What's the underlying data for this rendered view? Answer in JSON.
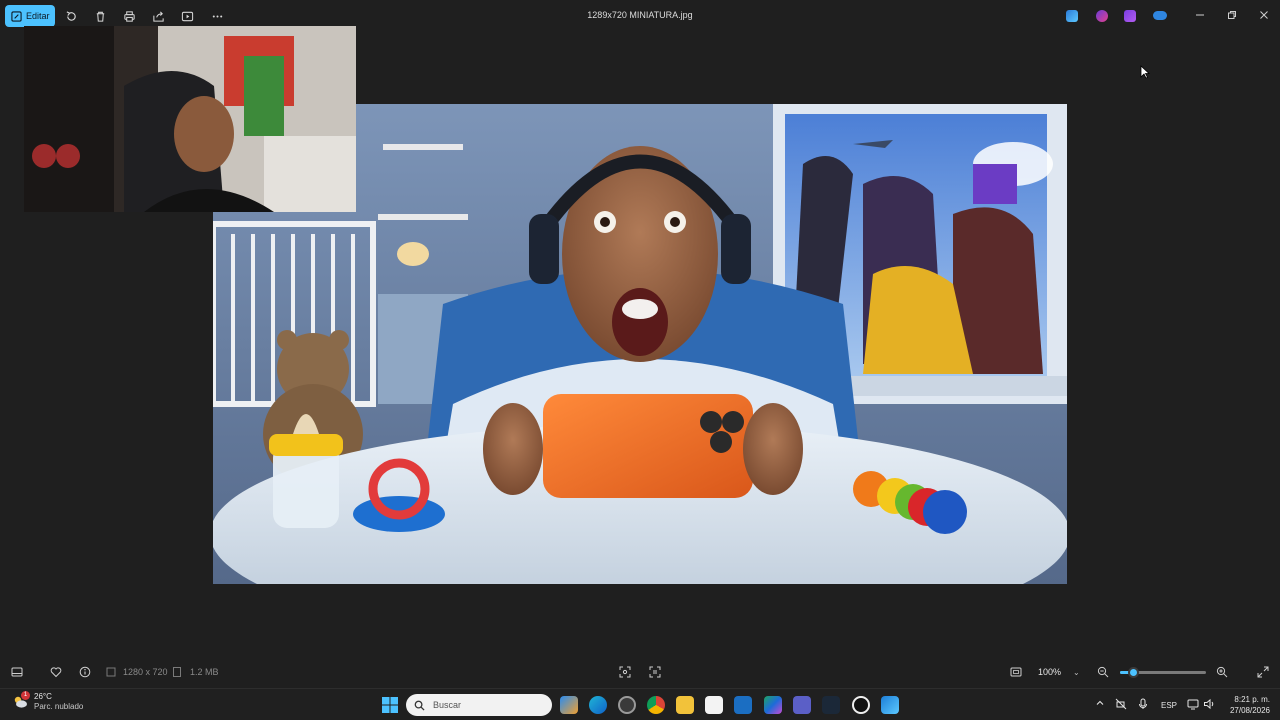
{
  "toolbar": {
    "edit_label": "Editar",
    "file_title": "1289x720 MINIATURA.jpg"
  },
  "status": {
    "dimensions": "1280 x 720",
    "file_size": "1.2 MB",
    "zoom": "100%",
    "zoom_fraction": 0.16
  },
  "taskbar": {
    "temperature": "26°C",
    "weather_condition": "Parc. nublado",
    "weather_badge": "1",
    "search_placeholder": "Buscar",
    "language": "ESP",
    "time": "8:21 p. m.",
    "date": "27/08/2026"
  },
  "colors": {
    "accent": "#4cc2ff",
    "background": "#1f1f1f",
    "taskbar": "#202020"
  }
}
